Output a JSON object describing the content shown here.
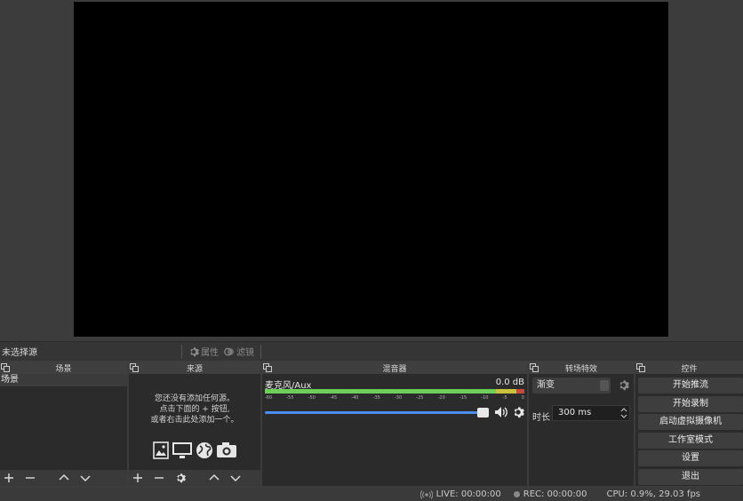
{
  "source_toolbar": {
    "no_source": "未选择源",
    "properties": "属性",
    "filters": "滤镜"
  },
  "docks": {
    "scenes": {
      "title": "场景",
      "items": [
        "场景"
      ]
    },
    "sources": {
      "title": "来源",
      "empty_line1": "您还没有添加任何源。",
      "empty_line2": "点击下面的 + 按钮,",
      "empty_line3": "或者右击此处添加一个。"
    },
    "mixer": {
      "title": "混音器",
      "channel_name": "麦克风/Aux",
      "channel_level": "0.0 dB",
      "volume_level": 0.98,
      "ticks": [
        "-60",
        "-55",
        "-50",
        "-45",
        "-40",
        "-35",
        "-30",
        "-25",
        "-20",
        "-15",
        "-10",
        "-5",
        "0"
      ]
    },
    "transitions": {
      "title": "转场特效",
      "selected": "渐变",
      "duration_label": "时长",
      "duration_value": "300 ms"
    },
    "controls": {
      "title": "控件",
      "buttons": [
        "开始推流",
        "开始录制",
        "启动虚拟摄像机",
        "工作室模式",
        "设置",
        "退出"
      ]
    }
  },
  "status_bar": {
    "live": "LIVE: 00:00:00",
    "rec": "REC: 00:00:00",
    "cpu": "CPU: 0.9%, 29.03 fps"
  },
  "colors": {
    "preview_bg": "#000000",
    "meter_green": "#6ccf5a",
    "volume_blue": "#4a8ef0"
  }
}
